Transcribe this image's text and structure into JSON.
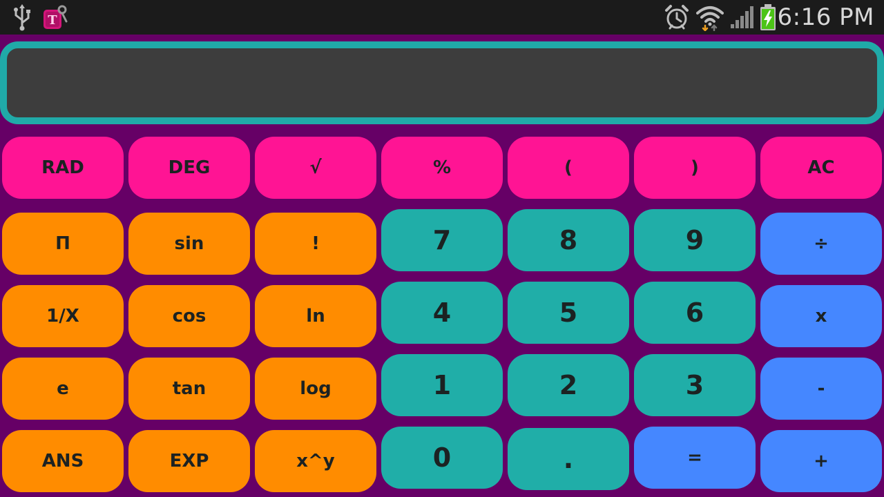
{
  "status_bar": {
    "time": "6:16 PM",
    "left_icons": [
      "usb-icon",
      "t-mobile-app-icon"
    ],
    "right_icons": [
      "alarm-icon",
      "wifi-icon",
      "signal-icon",
      "battery-charging-icon"
    ]
  },
  "display": {
    "value": ""
  },
  "colors": {
    "background": "#660066",
    "display_border": "#20aaa8",
    "display_fill": "#3d3d3d",
    "function_keys": "#ff1494",
    "scientific_keys": "#ff8c00",
    "number_keys": "#20aea8",
    "operator_keys": "#4587ff"
  },
  "keys": {
    "rad": "RAD",
    "deg": "DEG",
    "sqrt": "√",
    "percent": "%",
    "lparen": "(",
    "rparen": ")",
    "ac": "AC",
    "pi": "Π",
    "sin": "sin",
    "factorial": "!",
    "d7": "7",
    "d8": "8",
    "d9": "9",
    "divide": "÷",
    "reciprocal": "1/X",
    "cos": "cos",
    "ln": "ln",
    "d4": "4",
    "d5": "5",
    "d6": "6",
    "multiply": "x",
    "e": "e",
    "tan": "tan",
    "log": "log",
    "d1": "1",
    "d2": "2",
    "d3": "3",
    "minus": "-",
    "ans": "ANS",
    "exp": "EXP",
    "power": "x^y",
    "d0": "0",
    "dot": ".",
    "equals": "=",
    "plus": "+"
  }
}
